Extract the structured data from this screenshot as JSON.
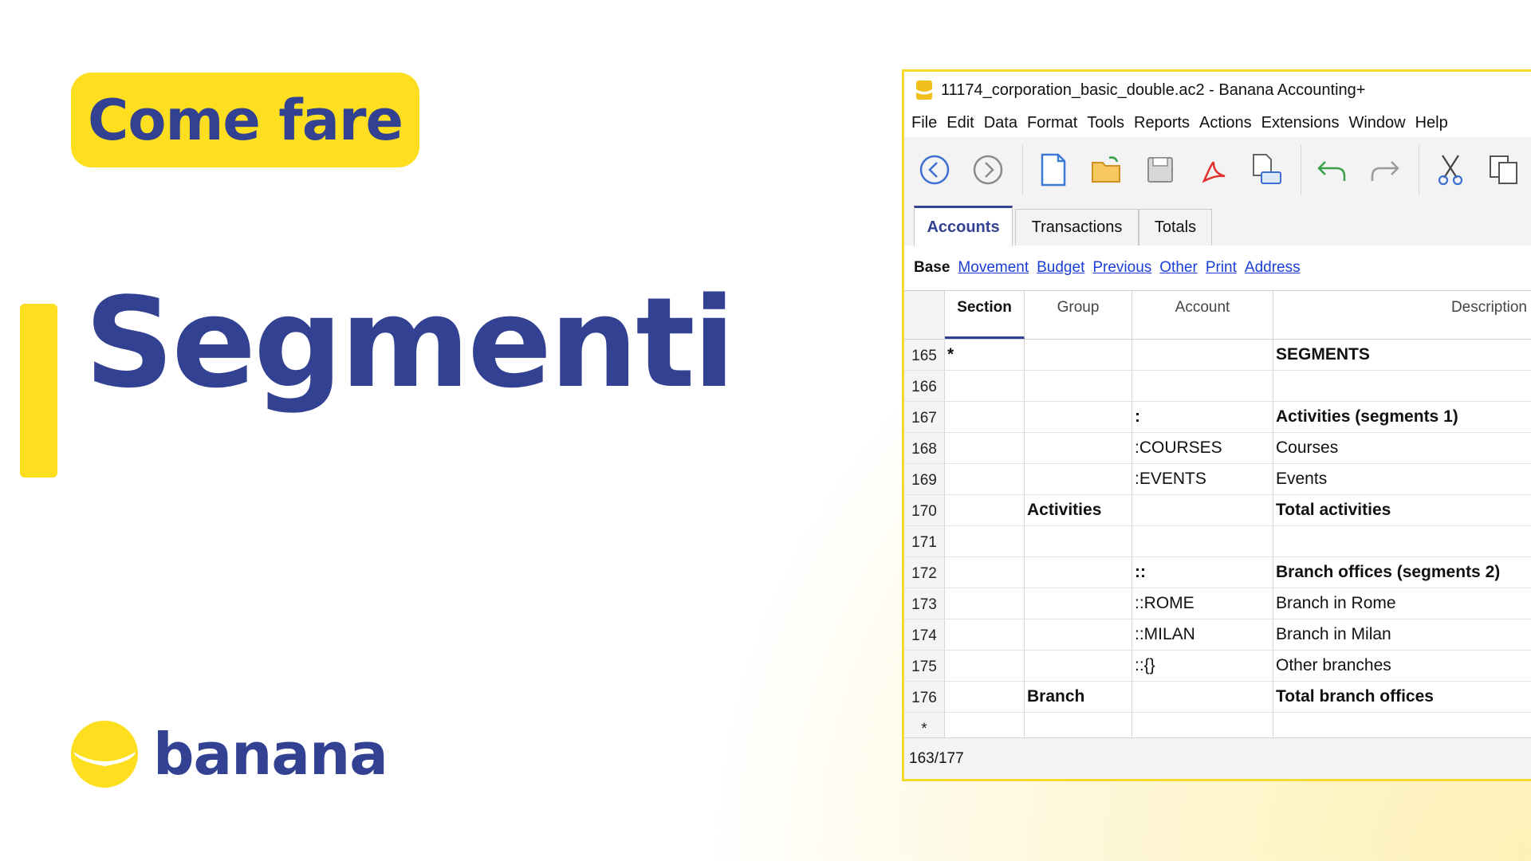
{
  "badge": "Come fare",
  "headline": "Segmenti",
  "logo": {
    "name": "banana",
    "icon": "banana-smile-logo"
  },
  "window": {
    "title": "11174_corporation_basic_double.ac2 - Banana Accounting+",
    "menu": [
      "File",
      "Edit",
      "Data",
      "Format",
      "Tools",
      "Reports",
      "Actions",
      "Extensions",
      "Window",
      "Help"
    ],
    "toolbar_icons": [
      "back-icon",
      "forward-icon",
      "new-file-icon",
      "open-folder-icon",
      "save-icon",
      "pdf-icon",
      "print-preview-icon",
      "undo-icon",
      "redo-icon",
      "cut-icon",
      "copy-icon"
    ],
    "tabs": [
      "Accounts",
      "Transactions",
      "Totals"
    ],
    "active_tab": "Accounts",
    "views": {
      "current": "Base",
      "links": [
        "Movement",
        "Budget",
        "Previous",
        "Other",
        "Print",
        "Address"
      ]
    },
    "columns": [
      "Section",
      "Group",
      "Account",
      "Description"
    ],
    "rows": [
      {
        "num": "165",
        "section": "*",
        "group": "",
        "account": "",
        "description": "SEGMENTS",
        "bold": true
      },
      {
        "num": "166",
        "section": "",
        "group": "",
        "account": "",
        "description": "",
        "bold": false
      },
      {
        "num": "167",
        "section": "",
        "group": "",
        "account": ":",
        "description": "Activities (segments 1)",
        "bold": true
      },
      {
        "num": "168",
        "section": "",
        "group": "",
        "account": ":COURSES",
        "description": "Courses",
        "bold": false
      },
      {
        "num": "169",
        "section": "",
        "group": "",
        "account": ":EVENTS",
        "description": "Events",
        "bold": false
      },
      {
        "num": "170",
        "section": "",
        "group": "Activities",
        "account": "",
        "description": "Total activities",
        "bold": true
      },
      {
        "num": "171",
        "section": "",
        "group": "",
        "account": "",
        "description": "",
        "bold": false
      },
      {
        "num": "172",
        "section": "",
        "group": "",
        "account": "::",
        "description": "Branch offices (segments 2)",
        "bold": true
      },
      {
        "num": "173",
        "section": "",
        "group": "",
        "account": "::ROME",
        "description": "Branch in Rome",
        "bold": false
      },
      {
        "num": "174",
        "section": "",
        "group": "",
        "account": "::MILAN",
        "description": "Branch in Milan",
        "bold": false
      },
      {
        "num": "175",
        "section": "",
        "group": "",
        "account": "::{}",
        "description": "Other branches",
        "bold": false
      },
      {
        "num": "176",
        "section": "",
        "group": "Branch",
        "account": "",
        "description": "Total branch offices",
        "bold": true
      },
      {
        "num": "*",
        "section": "",
        "group": "",
        "account": "",
        "description": "",
        "bold": false
      }
    ],
    "status": "163/177"
  },
  "colors": {
    "brand_blue": "#324192",
    "brand_yellow": "#fddf1f",
    "link_blue": "#1a3ed6"
  }
}
